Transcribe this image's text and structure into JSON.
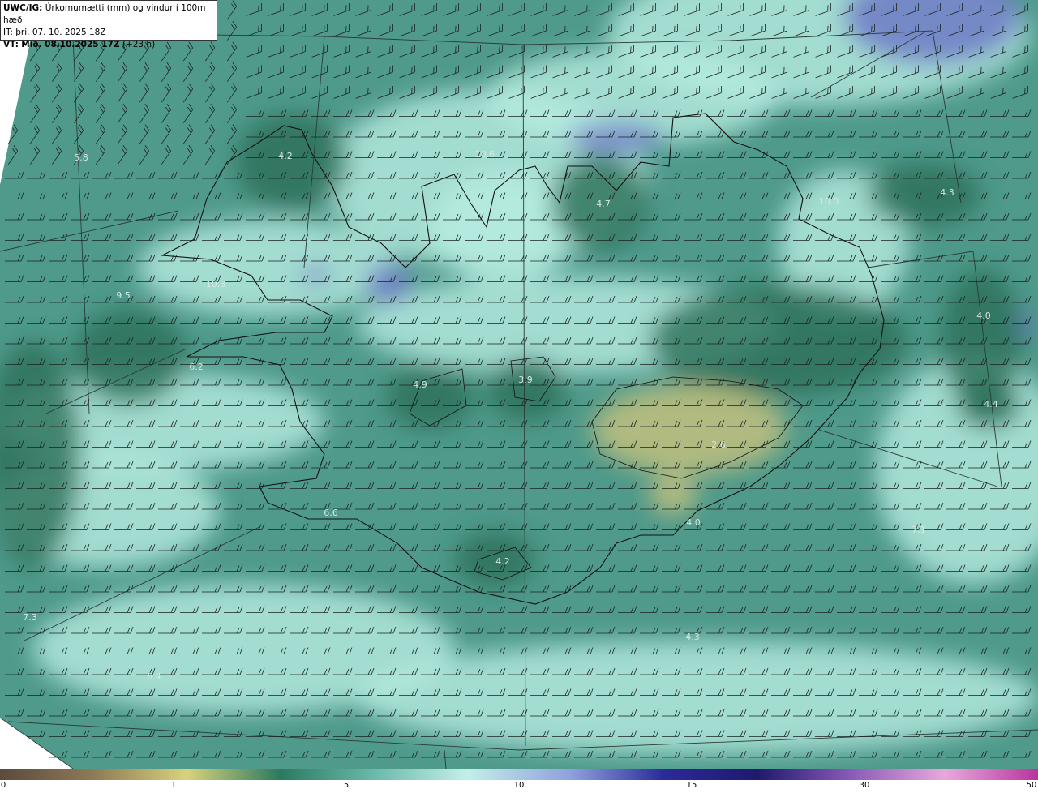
{
  "header": {
    "code": "UWC/IG:",
    "title": "Úrkomumætti (mm) og vindur í 100m hæð",
    "it_label": "IT:",
    "it_value": "þri. 07. 10. 2025 18Z",
    "vt_label": "VT:",
    "vt_value": "Mið. 08.10.2025 17Z",
    "vt_offset": "(+23 h)"
  },
  "colors": {
    "background": "#4f9a8b",
    "light": "#b8ece2",
    "dark": "#2a6e57",
    "yellow": "#c9c27d",
    "blue": "#6b74c6",
    "coast": "#111111",
    "grid": "#2b3b37",
    "barb": "#1a2320"
  },
  "labels": [
    {
      "text": "5.8"
    },
    {
      "text": "4.2"
    },
    {
      "text": "10.6"
    },
    {
      "text": "4.7"
    },
    {
      "text": "10.0"
    },
    {
      "text": "4.3"
    },
    {
      "text": "10.3"
    },
    {
      "text": "9.5"
    },
    {
      "text": "4.0"
    },
    {
      "text": "6.2"
    },
    {
      "text": "4.9"
    },
    {
      "text": "3.9"
    },
    {
      "text": "4.4"
    },
    {
      "text": "2.6"
    },
    {
      "text": "6.6"
    },
    {
      "text": "7.1"
    },
    {
      "text": "4.2"
    },
    {
      "text": "7.3"
    },
    {
      "text": "6.4"
    },
    {
      "text": "4.3"
    },
    {
      "text": "4.0"
    }
  ],
  "colorbar": {
    "ticks": [
      "0",
      "1",
      "5",
      "10",
      "15",
      "30",
      "50"
    ],
    "stops": [
      "#5c4a3c",
      "#8f7a55",
      "#d8d27c",
      "#2b7a5f",
      "#6ab9aa",
      "#c3efe8",
      "#8fa0dd",
      "#2a2a9a",
      "#1e1a6e",
      "#8a5ab8",
      "#e8a8dc",
      "#b8359e"
    ]
  }
}
